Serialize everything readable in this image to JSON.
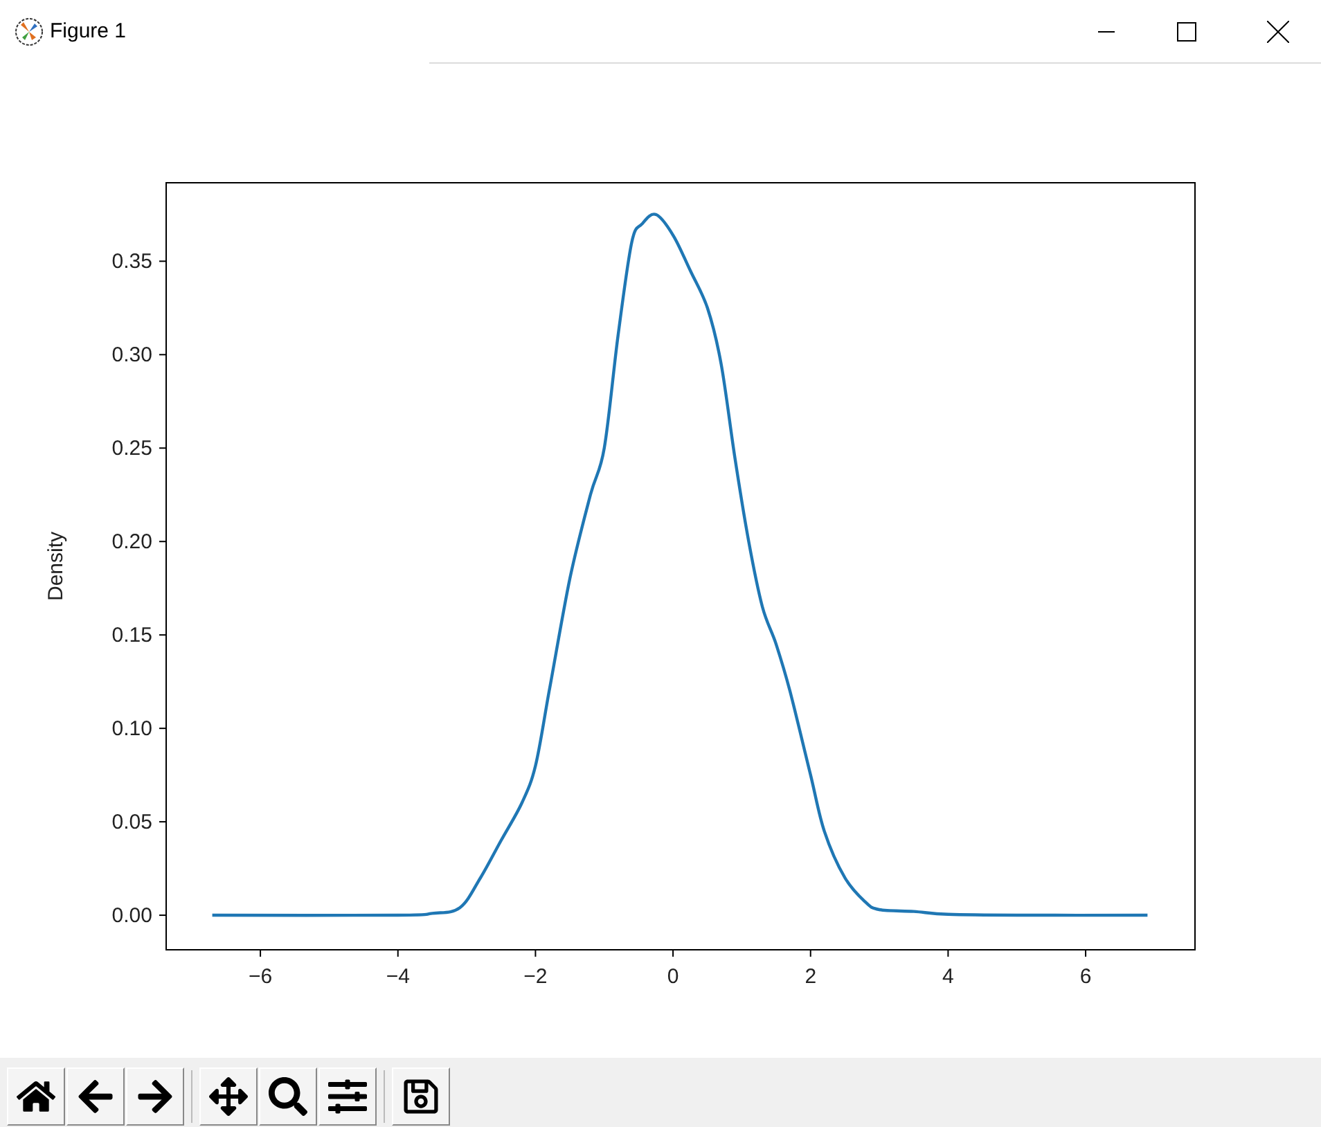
{
  "window": {
    "title": "Figure 1"
  },
  "figure": {
    "chart_data": {
      "type": "line",
      "ylabel": "Density",
      "xlim": [
        -7.37,
        7.59
      ],
      "ylim": [
        -0.0185,
        0.392
      ],
      "xticks": [
        {
          "value": -6,
          "label": "−6"
        },
        {
          "value": -4,
          "label": "−4"
        },
        {
          "value": -2,
          "label": "−2"
        },
        {
          "value": 0,
          "label": "0"
        },
        {
          "value": 2,
          "label": "2"
        },
        {
          "value": 4,
          "label": "4"
        },
        {
          "value": 6,
          "label": "6"
        }
      ],
      "yticks": [
        {
          "value": 0,
          "label": "0.00"
        },
        {
          "value": 0.05,
          "label": "0.05"
        },
        {
          "value": 0.1,
          "label": "0.10"
        },
        {
          "value": 0.15,
          "label": "0.15"
        },
        {
          "value": 0.2,
          "label": "0.20"
        },
        {
          "value": 0.25,
          "label": "0.25"
        },
        {
          "value": 0.3,
          "label": "0.30"
        },
        {
          "value": 0.35,
          "label": "0.35"
        }
      ],
      "x": [
        -6.7,
        -4,
        -3.5,
        -3.1,
        -2.8,
        -2.5,
        -2.2,
        -2,
        -1.8,
        -1.5,
        -1.2,
        -1,
        -0.8,
        -0.6,
        -0.45,
        -0.25,
        0,
        0.25,
        0.5,
        0.7,
        0.9,
        1.1,
        1.3,
        1.5,
        1.7,
        2,
        2.2,
        2.5,
        2.8,
        3,
        3.5,
        4,
        5,
        6.9
      ],
      "series": [
        {
          "color": "#1f77b4",
          "values": [
            0,
            0,
            0.001,
            0.004,
            0.02,
            0.04,
            0.06,
            0.08,
            0.12,
            0.18,
            0.225,
            0.25,
            0.31,
            0.36,
            0.37,
            0.375,
            0.364,
            0.345,
            0.325,
            0.295,
            0.245,
            0.2,
            0.165,
            0.145,
            0.12,
            0.075,
            0.045,
            0.02,
            0.007,
            0.003,
            0.002,
            0.0005,
            0,
            0
          ]
        }
      ]
    }
  }
}
